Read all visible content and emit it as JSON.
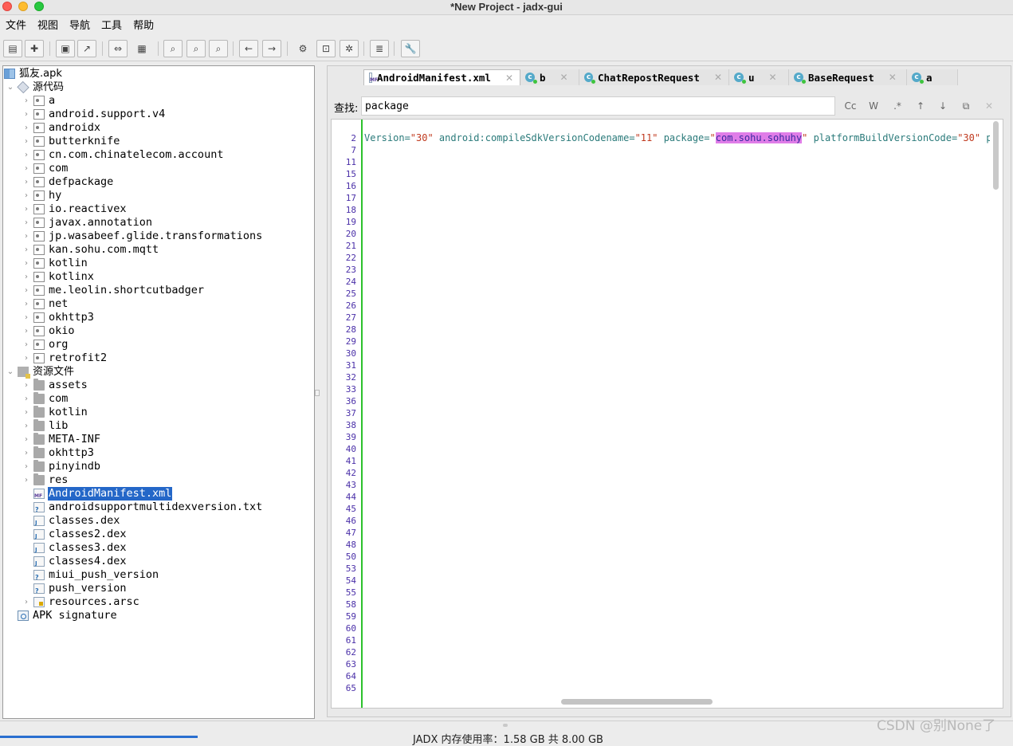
{
  "window": {
    "title": "*New Project - jadx-gui"
  },
  "menu": {
    "items": [
      "文件",
      "视图",
      "导航",
      "工具",
      "帮助"
    ]
  },
  "tree": {
    "root": "狐友.apk",
    "source_label": "源代码",
    "packages": [
      "a",
      "android.support.v4",
      "androidx",
      "butterknife",
      "cn.com.chinatelecom.account",
      "com",
      "defpackage",
      "hy",
      "io.reactivex",
      "javax.annotation",
      "jp.wasabeef.glide.transformations",
      "kan.sohu.com.mqtt",
      "kotlin",
      "kotlinx",
      "me.leolin.shortcutbadger",
      "net",
      "okhttp3",
      "okio",
      "org",
      "retrofit2"
    ],
    "resources_label": "资源文件",
    "res_folders": [
      "assets",
      "com",
      "kotlin",
      "lib",
      "META-INF",
      "okhttp3",
      "pinyindb",
      "res"
    ],
    "res_files": [
      "AndroidManifest.xml",
      "androidsupportmultidexversion.txt",
      "classes.dex",
      "classes2.dex",
      "classes3.dex",
      "classes4.dex",
      "miui_push_version",
      "push_version"
    ],
    "resources_arsc": "resources.arsc",
    "apk_signature": "APK signature"
  },
  "tabs": [
    {
      "label": "AndroidManifest.xml",
      "active": true
    },
    {
      "label": "b"
    },
    {
      "label": "ChatRepostRequest"
    },
    {
      "label": "u"
    },
    {
      "label": "BaseRequest"
    },
    {
      "label": "a"
    }
  ],
  "search": {
    "label": "查找:",
    "value": "package",
    "buttons": [
      "Cc",
      "W",
      ".*",
      "↑",
      "↓"
    ]
  },
  "editor": {
    "line_numbers": [
      "2",
      "7",
      "11",
      "15",
      "16",
      "17",
      "18",
      "19",
      "20",
      "21",
      "22",
      "23",
      "24",
      "25",
      "26",
      "27",
      "28",
      "29",
      "30",
      "31",
      "32",
      "33",
      "36",
      "37",
      "38",
      "39",
      "40",
      "41",
      "42",
      "43",
      "44",
      "45",
      "46",
      "47",
      "48",
      "50",
      "53",
      "54",
      "55",
      "58",
      "59",
      "60",
      "61",
      "62",
      "63",
      "64",
      "65"
    ],
    "code": {
      "a1": "Version=",
      "s1": "\"30\"",
      "a2": " android:compileSdkVersionCodename=",
      "s2": "\"11\"",
      "a3": " package=",
      "q1": "\"",
      "hl": "com.sohu.sohuhy",
      "q2": "\"",
      "a4": " platformBuildVersionCode=",
      "s3": "\"30\"",
      "a5": " plat"
    }
  },
  "status": {
    "memory": "JADX 内存使用率：1.58 GB 共 8.00 GB",
    "progress": 0.195
  },
  "watermark": "CSDN @别None了"
}
